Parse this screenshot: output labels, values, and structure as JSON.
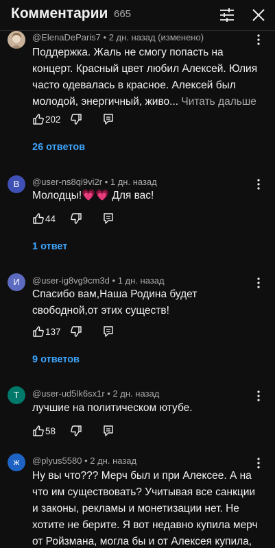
{
  "header": {
    "title": "Комментарии",
    "count": "665"
  },
  "comments": [
    {
      "author": "@ElenaDeParis7",
      "time": "2 дн. назад (изменено)",
      "text": "Поддержка. Жаль не смогу попасть на концерт. Красный цвет любил Алексей. Юлия часто одевалась в красное. Алексей был молодой, энергичный, живо...",
      "read_more": "Читать дальше",
      "likes": "202",
      "replies": "26 ответов"
    },
    {
      "avatar_letter": "B",
      "avatar_color": "#3f51b5",
      "author": "@user-ns8qi9vi2r",
      "time": "1 дн. назад",
      "text_start": "Молодцы!",
      "hearts": "💗💗",
      "text_end": " Для вас!",
      "likes": "44",
      "replies": "1 ответ"
    },
    {
      "avatar_letter": "И",
      "avatar_color": "#5c6bc0",
      "author": "@user-ig8vg9cm3d",
      "time": "1 дн. назад",
      "text": "Спасибо вам,Наша Родина будет свободной,от этих существ!",
      "likes": "137",
      "replies": "9 ответов"
    },
    {
      "avatar_letter": "T",
      "avatar_color": "#00796b",
      "author": "@user-ud5lk6sx1r",
      "time": "2 дн. назад",
      "text": "лучшие на политическом ютубе.",
      "likes": "58"
    },
    {
      "avatar_letter": "ж",
      "avatar_color": "#1e63c4",
      "author": "@plyus5580",
      "time": "2 дн. назад",
      "text": "Ну вы что??? Мерч был и при Алексее. А на что им существовать? Учитывая все санкции и законы, рекламы и монетизации нет. Не хотите не берите. Я вот недавно купила мерч от Ройзмана, могла бы и от Алексея купила,"
    }
  ]
}
